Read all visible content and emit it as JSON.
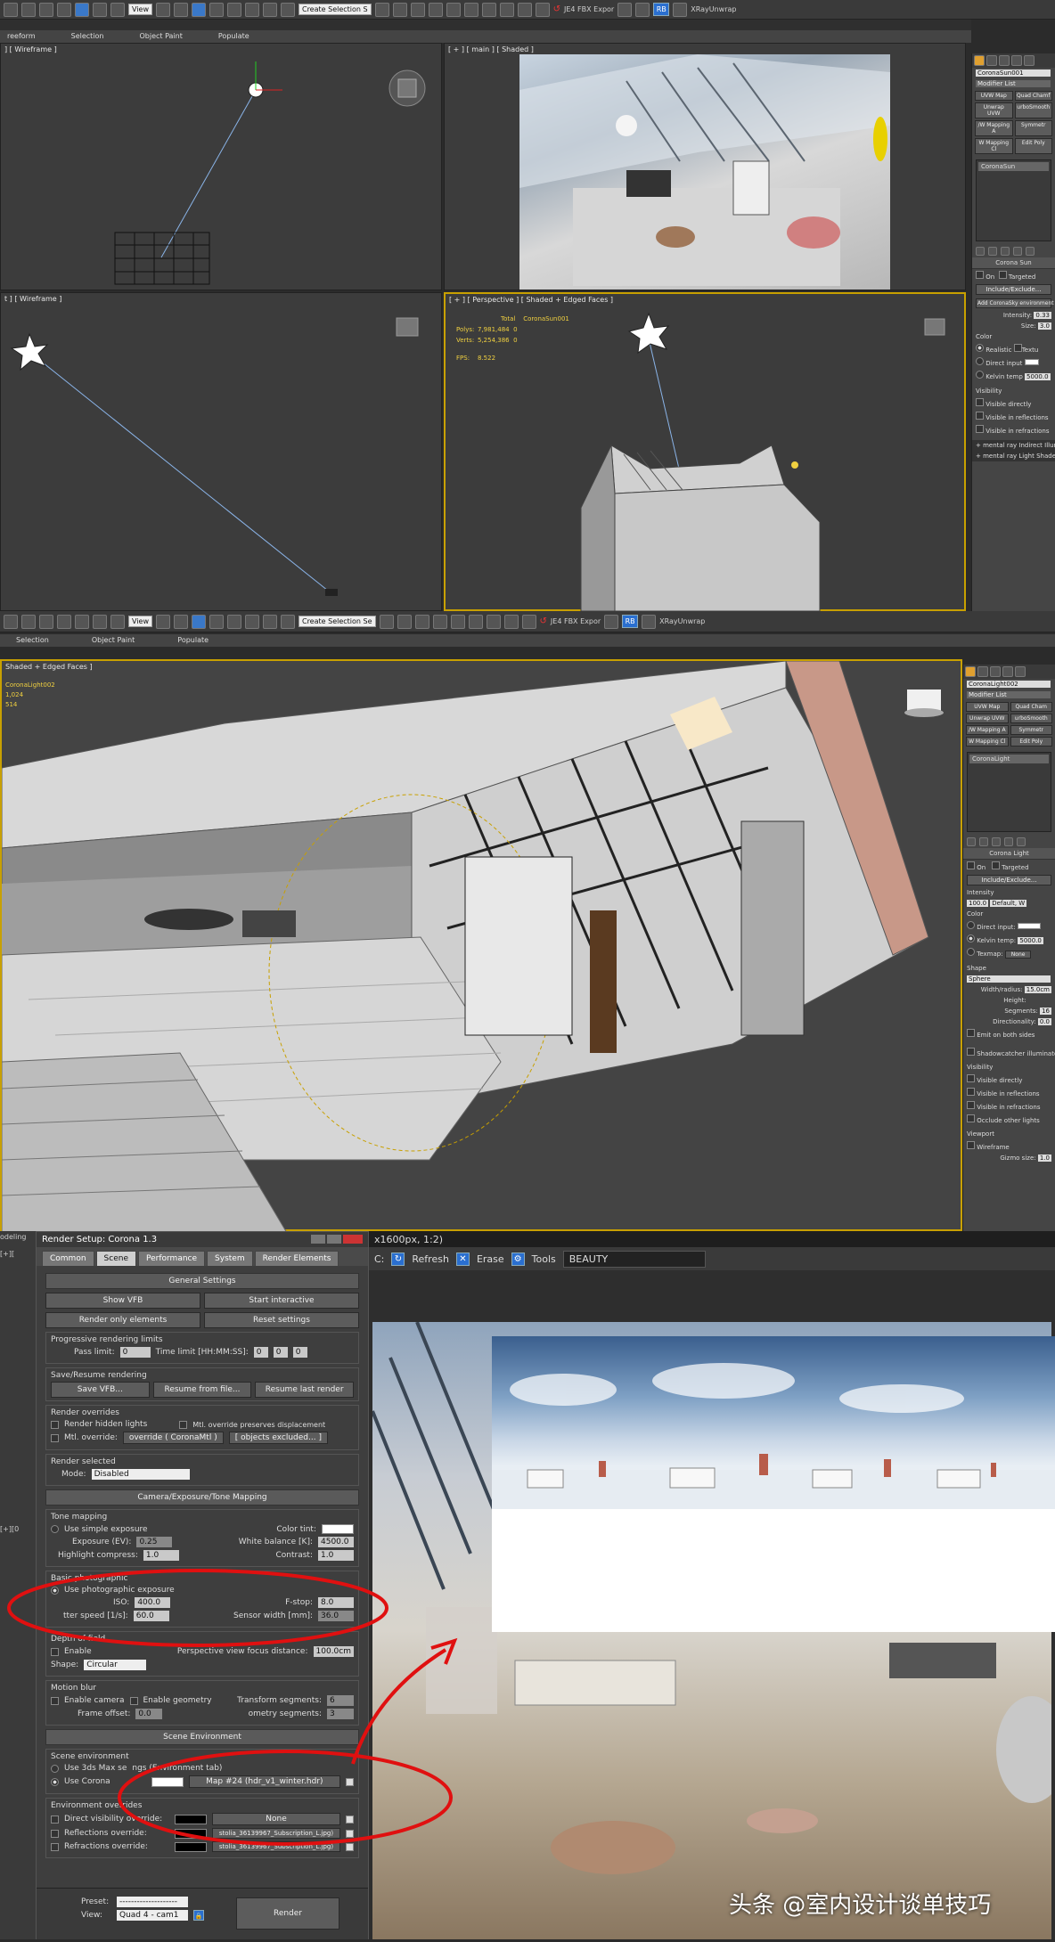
{
  "top_toolbar": {
    "view_dropdown": "View",
    "selection_set": "Create Selection S",
    "fbx_export": "JE4 FBX Expor",
    "rb_label": "RB",
    "xray_label": "XRayUnwrap"
  },
  "top_subtabs": [
    "reeform",
    "Selection",
    "Object Paint",
    "Populate"
  ],
  "viewports_top": {
    "tl_label": "] [ Wireframe ]",
    "tr_label": "[ + ] [ main ] [ Shaded ]",
    "bl_label": "t ] [ Wireframe ]",
    "br_label": "[ + ] [ Perspective ] [ Shaded + Edged Faces ]",
    "stats": {
      "total_label": "Total",
      "object_name": "CoronaSun001",
      "polys_label": "Polys:",
      "polys_total": "7,981,484",
      "polys_obj": "0",
      "verts_label": "Verts:",
      "verts_total": "5,254,386",
      "verts_obj": "0",
      "fps_label": "FPS:",
      "fps_value": "8.522"
    }
  },
  "right_panel_1": {
    "object_name": "CoronaSun001",
    "modifier_list": "Modifier List",
    "modifiers": [
      "UVW Map",
      "Quad Chamf",
      "Unwrap UVW",
      "urboSmooth",
      "/W Mapping A",
      "Symmetr",
      "W Mapping Cl",
      "Edit Poly"
    ],
    "stack_item": "CoronaSun",
    "rollout": "Corona Sun",
    "on_label": "On",
    "targeted_label": "Targeted",
    "include_exclude": "Include/Exclude...",
    "add_sky": "Add CoronaSky environment",
    "intensity_label": "Intensity:",
    "intensity_value": "0.33",
    "size_label": "Size:",
    "size_value": "3.0",
    "color_label": "Color",
    "realistic": "Realistic",
    "textured": "Textu",
    "direct_input": "Direct input",
    "kelvin_temp": "Kelvin temp",
    "kelvin_value": "5000.0",
    "visibility": "Visibility",
    "visible_directly": "Visible directly",
    "visible_reflections": "Visible in reflections",
    "visible_refractions": "Visible in refractions",
    "mr_indirect": "mental ray Indirect Illuminat",
    "mr_shader": "mental ray Light Shader"
  },
  "mid_toolbar": {
    "view_dropdown": "View",
    "selection_set": "Create Selection Se",
    "fbx_export": "JE4 FBX Expor",
    "rb_label": "RB",
    "xray_label": "XRayUnwrap"
  },
  "mid_subtabs": [
    "Selection",
    "Object Paint",
    "Populate"
  ],
  "big_viewport": {
    "label": "Shaded + Edged Faces ]",
    "obj_name": "CoronaLight002",
    "val1": "1,024",
    "val2": "514"
  },
  "right_panel_2": {
    "object_name": "CoronaLight002",
    "modifier_list": "Modifier List",
    "modifiers": [
      "UVW Map",
      "Quad Cham",
      "Unwrap UVW",
      "urboSmooth",
      "/W Mapping A",
      "Symmetr",
      "W Mapping Cl",
      "Edit Poly"
    ],
    "stack_item": "CoronaLight",
    "rollout": "Corona Light",
    "on_label": "On",
    "targeted_label": "Targeted",
    "include_exclude": "Include/Exclude...",
    "intensity_label": "Intensity",
    "intensity_value": "100.0",
    "intensity_unit": "Default, W",
    "color_label": "Color",
    "direct_input": "Direct input:",
    "kelvin_temp": "Kelvin temp:",
    "kelvin_value": "5000.0",
    "texmap": "Texmap:",
    "texmap_value": "None",
    "shape_label": "Shape",
    "shape_value": "Sphere",
    "width_label": "Width/radius:",
    "width_value": "15.0cm",
    "height_label": "Height:",
    "segments_label": "Segments:",
    "segments_value": "16",
    "directionality_label": "Directionality:",
    "directionality_value": "0.0",
    "emit_both": "Emit on both sides",
    "shadowcatcher": "Shadowcatcher illuminator",
    "visibility": "Visibility",
    "visible_directly": "Visible directly",
    "visible_reflections": "Visible in reflections",
    "visible_refractions": "Visible in refractions",
    "occlude": "Occlude other lights",
    "viewport": "Viewport",
    "wireframe": "Wireframe",
    "gizmo_size": "Gizmo size:",
    "gizmo_value": "1.0"
  },
  "render_setup": {
    "title": "Render Setup: Corona 1.3",
    "tabs": [
      "Common",
      "Scene",
      "Performance",
      "System",
      "Render Elements"
    ],
    "general_settings": "General Settings",
    "show_vfb": "Show VFB",
    "start_interactive": "Start interactive",
    "render_only_elements": "Render only elements",
    "reset_settings": "Reset settings",
    "progressive_limits": "Progressive rendering limits",
    "pass_limit_label": "Pass limit:",
    "pass_limit_value": "0",
    "time_limit_label": "Time limit [HH:MM:SS]:",
    "time_h": "0",
    "time_m": "0",
    "time_s": "0",
    "save_resume": "Save/Resume rendering",
    "save_vfb": "Save VFB...",
    "resume_from_file": "Resume from file...",
    "resume_last": "Resume last render",
    "render_overrides": "Render overrides",
    "render_hidden": "Render hidden lights",
    "mtl_override_displacement": "Mtl. override preserves displacement",
    "mtl_override": "Mtl. override:",
    "override_value": "override ( CoronaMtl )",
    "objects_excluded": "[ objects excluded... ]",
    "render_selected": "Render selected",
    "mode_label": "Mode:",
    "mode_value": "Disabled",
    "camera_section": "Camera/Exposure/Tone Mapping",
    "tone_mapping": "Tone mapping",
    "use_simple": "Use simple exposure",
    "color_tint": "Color tint:",
    "exposure_label": "Exposure (EV):",
    "exposure_value": "0.25",
    "white_balance_label": "White balance [K]:",
    "white_balance_value": "4500.0",
    "highlight_label": "Highlight compress:",
    "highlight_value": "1.0",
    "contrast_label": "Contrast:",
    "contrast_value": "1.0",
    "basic_photo": "Basic photographic",
    "use_photo": "Use photographic exposure",
    "iso_label": "ISO:",
    "iso_value": "400.0",
    "fstop_label": "F-stop:",
    "fstop_value": "8.0",
    "shutter_label": "tter speed [1/s]:",
    "shutter_value": "60.0",
    "sensor_label": "Sensor width [mm]:",
    "sensor_value": "36.0",
    "dof": "Depth of field",
    "enable": "Enable",
    "focus_label": "Perspective view focus distance:",
    "focus_value": "100.0cm",
    "shape_label": "Shape:",
    "shape_value": "Circular",
    "motion_blur": "Motion blur",
    "enable_camera": "Enable camera",
    "enable_geometry": "Enable geometry",
    "transform_segments": "Transform segments:",
    "transform_value": "6",
    "frame_offset": "Frame offset:",
    "frame_value": "0.0",
    "geometry_segments": "ometry segments:",
    "geometry_value": "3",
    "scene_environment": "Scene Environment",
    "scene_env_group": "Scene environment",
    "use_3dsmax": "Use 3ds Max se",
    "use_3dsmax_tail": "ngs (Environment tab)",
    "use_corona": "Use Corona",
    "env_map": "Map #24 (hdr_v1_winter.hdr)",
    "env_overrides": "Environment overrides",
    "direct_vis": "Direct visibility override:",
    "direct_vis_map": "None",
    "reflections_override": "Reflections override:",
    "reflections_map": "stolia_36139967_Subscription_L.jpg)",
    "refractions_override": "Refractions override:",
    "refractions_map": "stolia_36139967_Subscription_L.jpg)",
    "preset_label": "Preset:",
    "preset_value": "--------------------",
    "view_label": "View:",
    "view_value": "Quad 4 - cam1",
    "render_button": "Render",
    "behind_label": "odeling",
    "behind_vp": "[+][",
    "behind_vp2": "[+][0"
  },
  "vfb": {
    "title_frag": "x1600px, 1:2)",
    "c_label": "C:",
    "refresh": "Refresh",
    "erase": "Erase",
    "tools": "Tools",
    "channel": "BEAUTY"
  },
  "watermark": "头条 @室内设计谈单技巧",
  "colors": {
    "active_border": "#c8a000",
    "annotation_red": "#e01010",
    "render_btn_blue": "#3b6fb6"
  }
}
